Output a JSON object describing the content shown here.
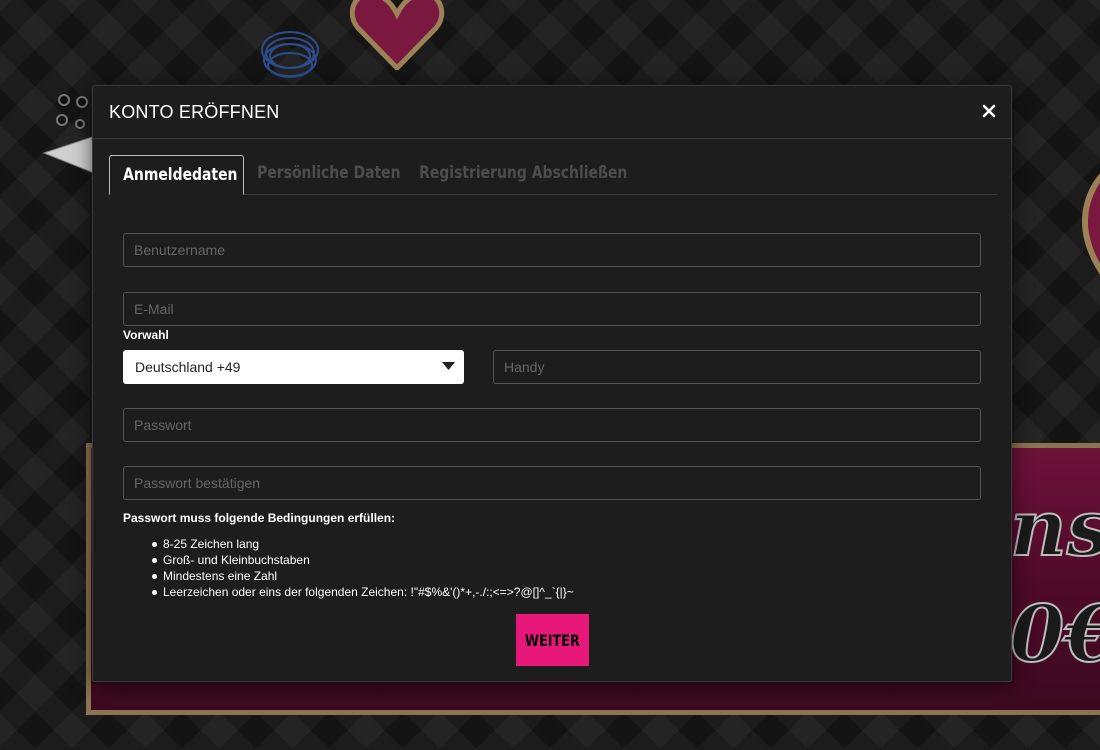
{
  "modal": {
    "title": "KONTO ERÖFFNEN",
    "close_icon": "close-icon"
  },
  "tabs": [
    {
      "label": "Anmeldedaten",
      "active": true
    },
    {
      "label": "Persönliche Daten",
      "active": false
    },
    {
      "label": "Registrierung Abschließen",
      "active": false
    }
  ],
  "form": {
    "username": {
      "placeholder": "Benutzername",
      "value": ""
    },
    "email": {
      "placeholder": "E-Mail",
      "value": ""
    },
    "prefix_label": "Vorwahl",
    "prefix_select": {
      "value": "Deutschland +49",
      "icon": "chevron-down-icon"
    },
    "mobile": {
      "placeholder": "Handy",
      "value": ""
    },
    "password": {
      "placeholder": "Passwort",
      "value": ""
    },
    "password_confirm": {
      "placeholder": "Passwort bestätigen",
      "value": ""
    }
  },
  "rules": {
    "title": "Passwort muss folgende Bedingungen erfüllen:",
    "items": [
      "8-25 Zeichen lang",
      "Groß- und Kleinbuchstaben",
      "Mindestens eine Zahl",
      "Leerzeichen oder eins der folgenden Zeichen: !\"#$%&'()*+,-./:;<=>?@[]^_`{|}~"
    ]
  },
  "submit_label": "WEITER",
  "colors": {
    "accent": "#e8177a",
    "modal_bg": "#1d1d1d",
    "promo_bg": "#6e1238",
    "promo_border": "#8b7550"
  }
}
